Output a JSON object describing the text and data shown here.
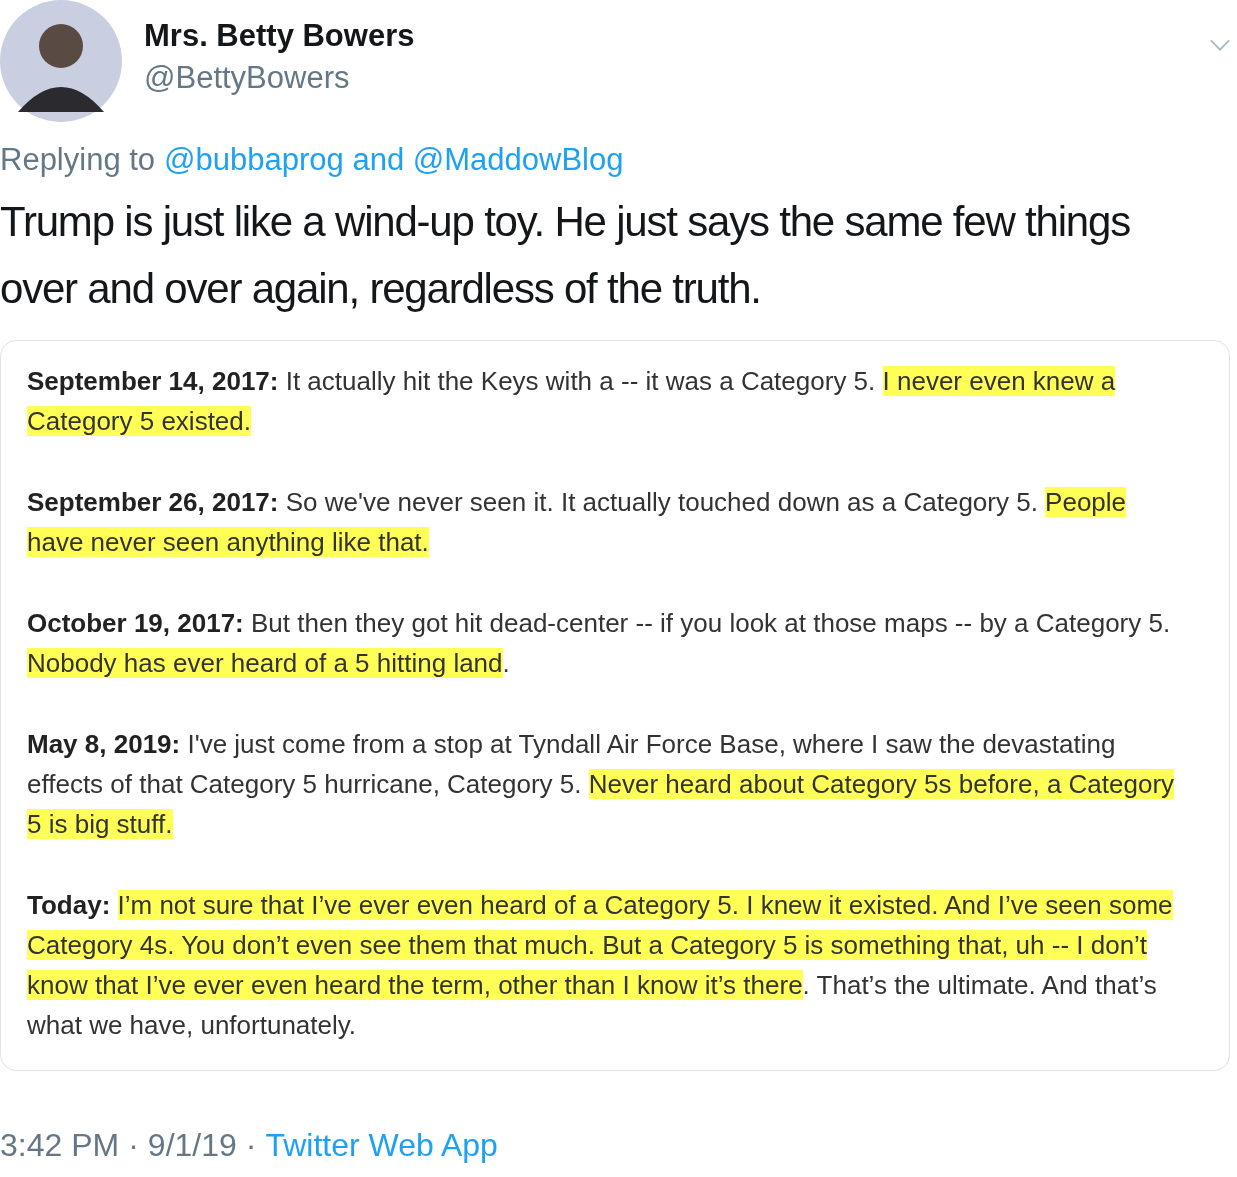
{
  "author": {
    "name": "Mrs. Betty Bowers",
    "handle": "@BettyBowers"
  },
  "reply": {
    "prefix": "Replying to",
    "mentions": "@bubbaprog and @MaddowBlog"
  },
  "text": "Trump is just like a wind-up toy. He just says the same few things over and over again, regardless of the truth.",
  "quotes": [
    {
      "date": "September 14, 2017:",
      "segments": [
        {
          "text": "It actually hit the Keys with a -- it was a Category 5. ",
          "highlighted": false
        },
        {
          "text": "I never even knew a Category 5 existed.",
          "highlighted": true
        }
      ]
    },
    {
      "date": "September 26, 2017:",
      "segments": [
        {
          "text": "So we've never seen it. It actually touched down as a Category 5. ",
          "highlighted": false
        },
        {
          "text": "People have never seen anything like that.",
          "highlighted": true
        }
      ]
    },
    {
      "date": "October 19, 2017:",
      "segments": [
        {
          "text": "But then they got hit dead-center -- if you look at those maps -- by a Category 5. ",
          "highlighted": false
        },
        {
          "text": "Nobody has ever heard of a 5 hitting land",
          "highlighted": true
        },
        {
          "text": ".",
          "highlighted": false
        }
      ]
    },
    {
      "date": "May 8, 2019:",
      "segments": [
        {
          "text": "I've just come from a stop at Tyndall Air Force Base, where I saw the devastating effects of that Category 5 hurricane, Category 5. ",
          "highlighted": false
        },
        {
          "text": "Never heard about Category 5s before, a Category 5 is big stuff.",
          "highlighted": true
        }
      ]
    },
    {
      "date": "Today:",
      "segments": [
        {
          "text": "I’m not sure that I’ve ever even heard of a Category 5. I knew it existed. And I’ve seen some Category 4s. You don’t even see them that much. But a Category 5 is something that, uh -- I don’t know that I’ve ever even heard the term, other than I know it’s there",
          "highlighted": true
        },
        {
          "text": ". That’s the ultimate. And that’s what we have, unfortunately.",
          "highlighted": false
        }
      ]
    }
  ],
  "meta": {
    "time": "3:42 PM",
    "separator": "·",
    "date": "9/1/19",
    "source": "Twitter Web App"
  }
}
